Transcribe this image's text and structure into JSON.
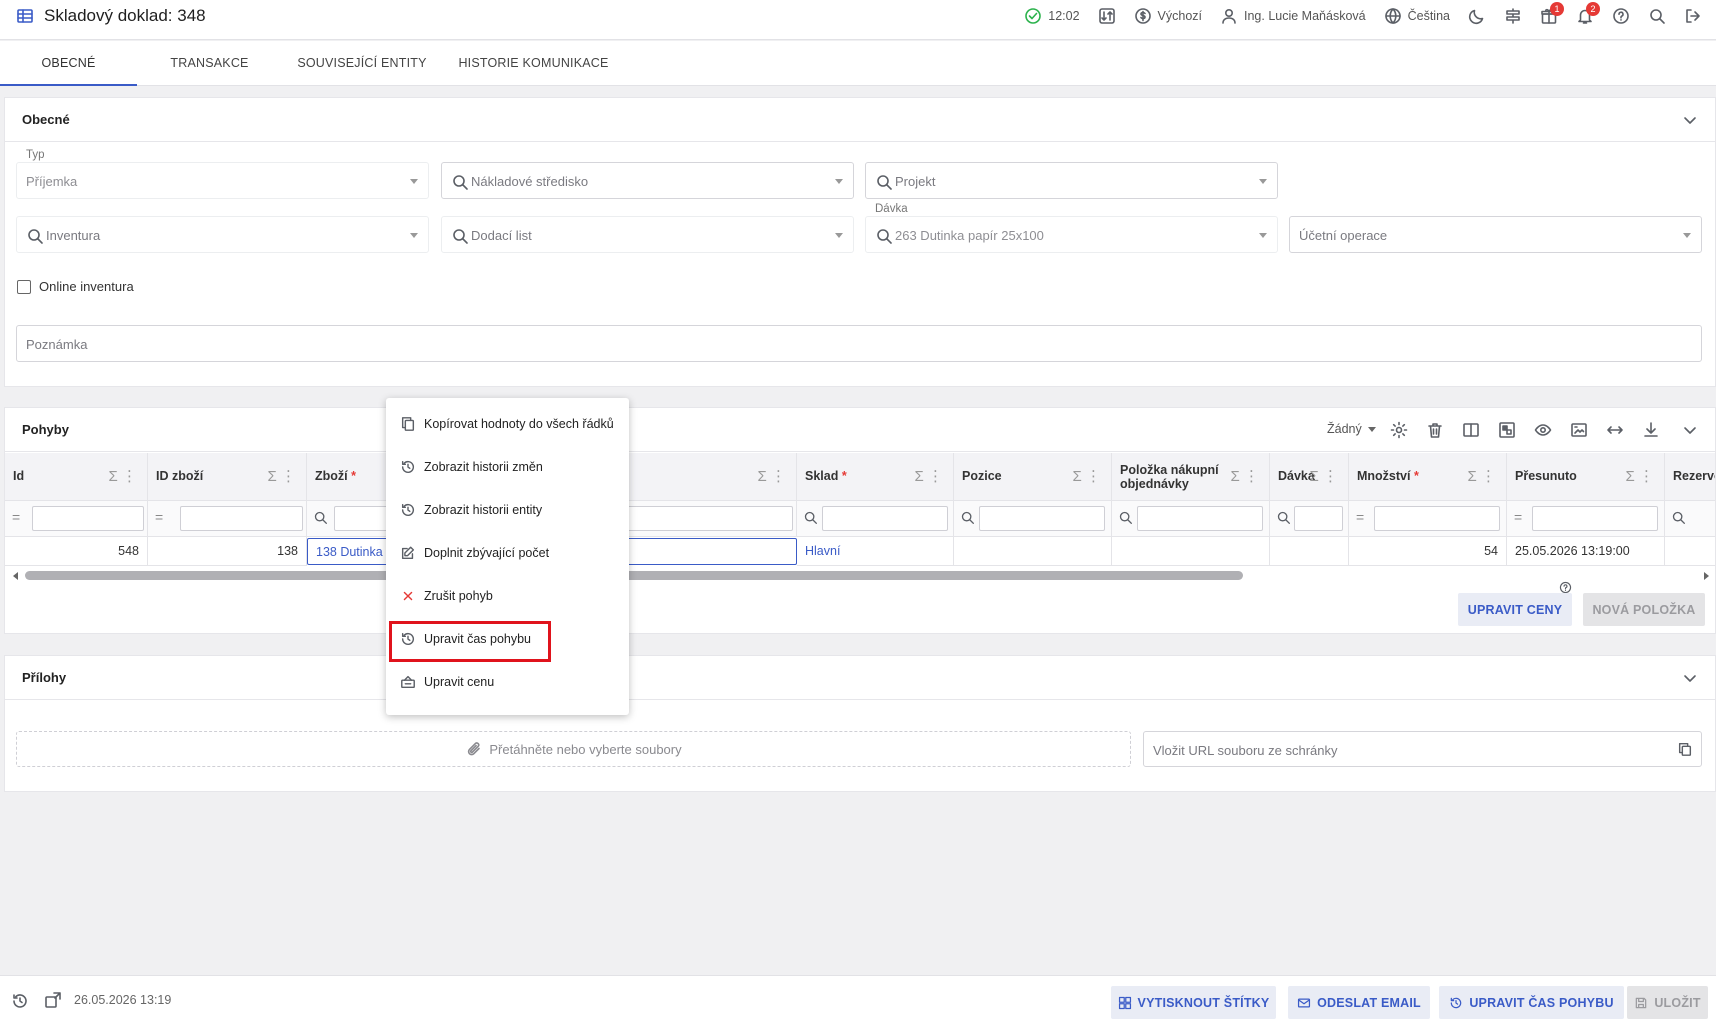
{
  "header": {
    "title": "Skladový doklad: 348",
    "time": "12:02",
    "profile": "Výchozí",
    "user": "Ing. Lucie Maňásková",
    "language": "Čeština",
    "gift_badge": "1",
    "notif_badge": "2"
  },
  "tabs": [
    "OBECNÉ",
    "TRANSAKCE",
    "SOUVISEJÍCÍ ENTITY",
    "HISTORIE KOMUNIKACE"
  ],
  "general": {
    "title": "Obecné",
    "type_label": "Typ",
    "type_value": "Příjemka",
    "cost_center_placeholder": "Nákladové středisko",
    "project_placeholder": "Projekt",
    "inventory_placeholder": "Inventura",
    "delivery_note_placeholder": "Dodací list",
    "batch_label": "Dávka",
    "batch_value": "263 Dutinka papír 25x100",
    "accounting_placeholder": "Účetní operace",
    "online_inventory_label": "Online inventura",
    "note_placeholder": "Poznámka"
  },
  "movements": {
    "title": "Pohyby",
    "view_select": "Žádný",
    "columns": [
      "Id",
      "ID zboží",
      "Zboží",
      "Sklad",
      "Pozice",
      "Položka nákupní objednávky",
      "Dávka",
      "Množství",
      "Přesunuto",
      "Rezervov"
    ],
    "row": {
      "id": "548",
      "goods_id": "138",
      "goods": "138 Dutinka p",
      "warehouse": "Hlavní",
      "quantity": "54",
      "moved": "25.05.2026 13:19:00"
    },
    "btn_edit_prices": "UPRAVIT CENY",
    "btn_new_item": "NOVÁ POLOŽKA"
  },
  "context_menu": [
    "Kopírovat hodnoty do všech řádků",
    "Zobrazit historii změn",
    "Zobrazit historii entity",
    "Doplnit zbývající počet",
    "Zrušit pohyb",
    "Upravit čas pohybu",
    "Upravit cenu"
  ],
  "attachments": {
    "title": "Přílohy",
    "drop_text": "Přetáhněte nebo vyberte soubory",
    "url_placeholder": "Vložit URL souboru ze schránky"
  },
  "footer": {
    "timestamp": "26.05.2026 13:19",
    "btn_print": "VYTISKNOUT ŠTÍTKY",
    "btn_email": "ODESLAT EMAIL",
    "btn_time": "UPRAVIT ČAS POHYBU",
    "btn_save": "ULOŽIT"
  },
  "colors": {
    "accent": "#3a5bc7",
    "highlight": "#e0131c",
    "required": "#e53935"
  }
}
